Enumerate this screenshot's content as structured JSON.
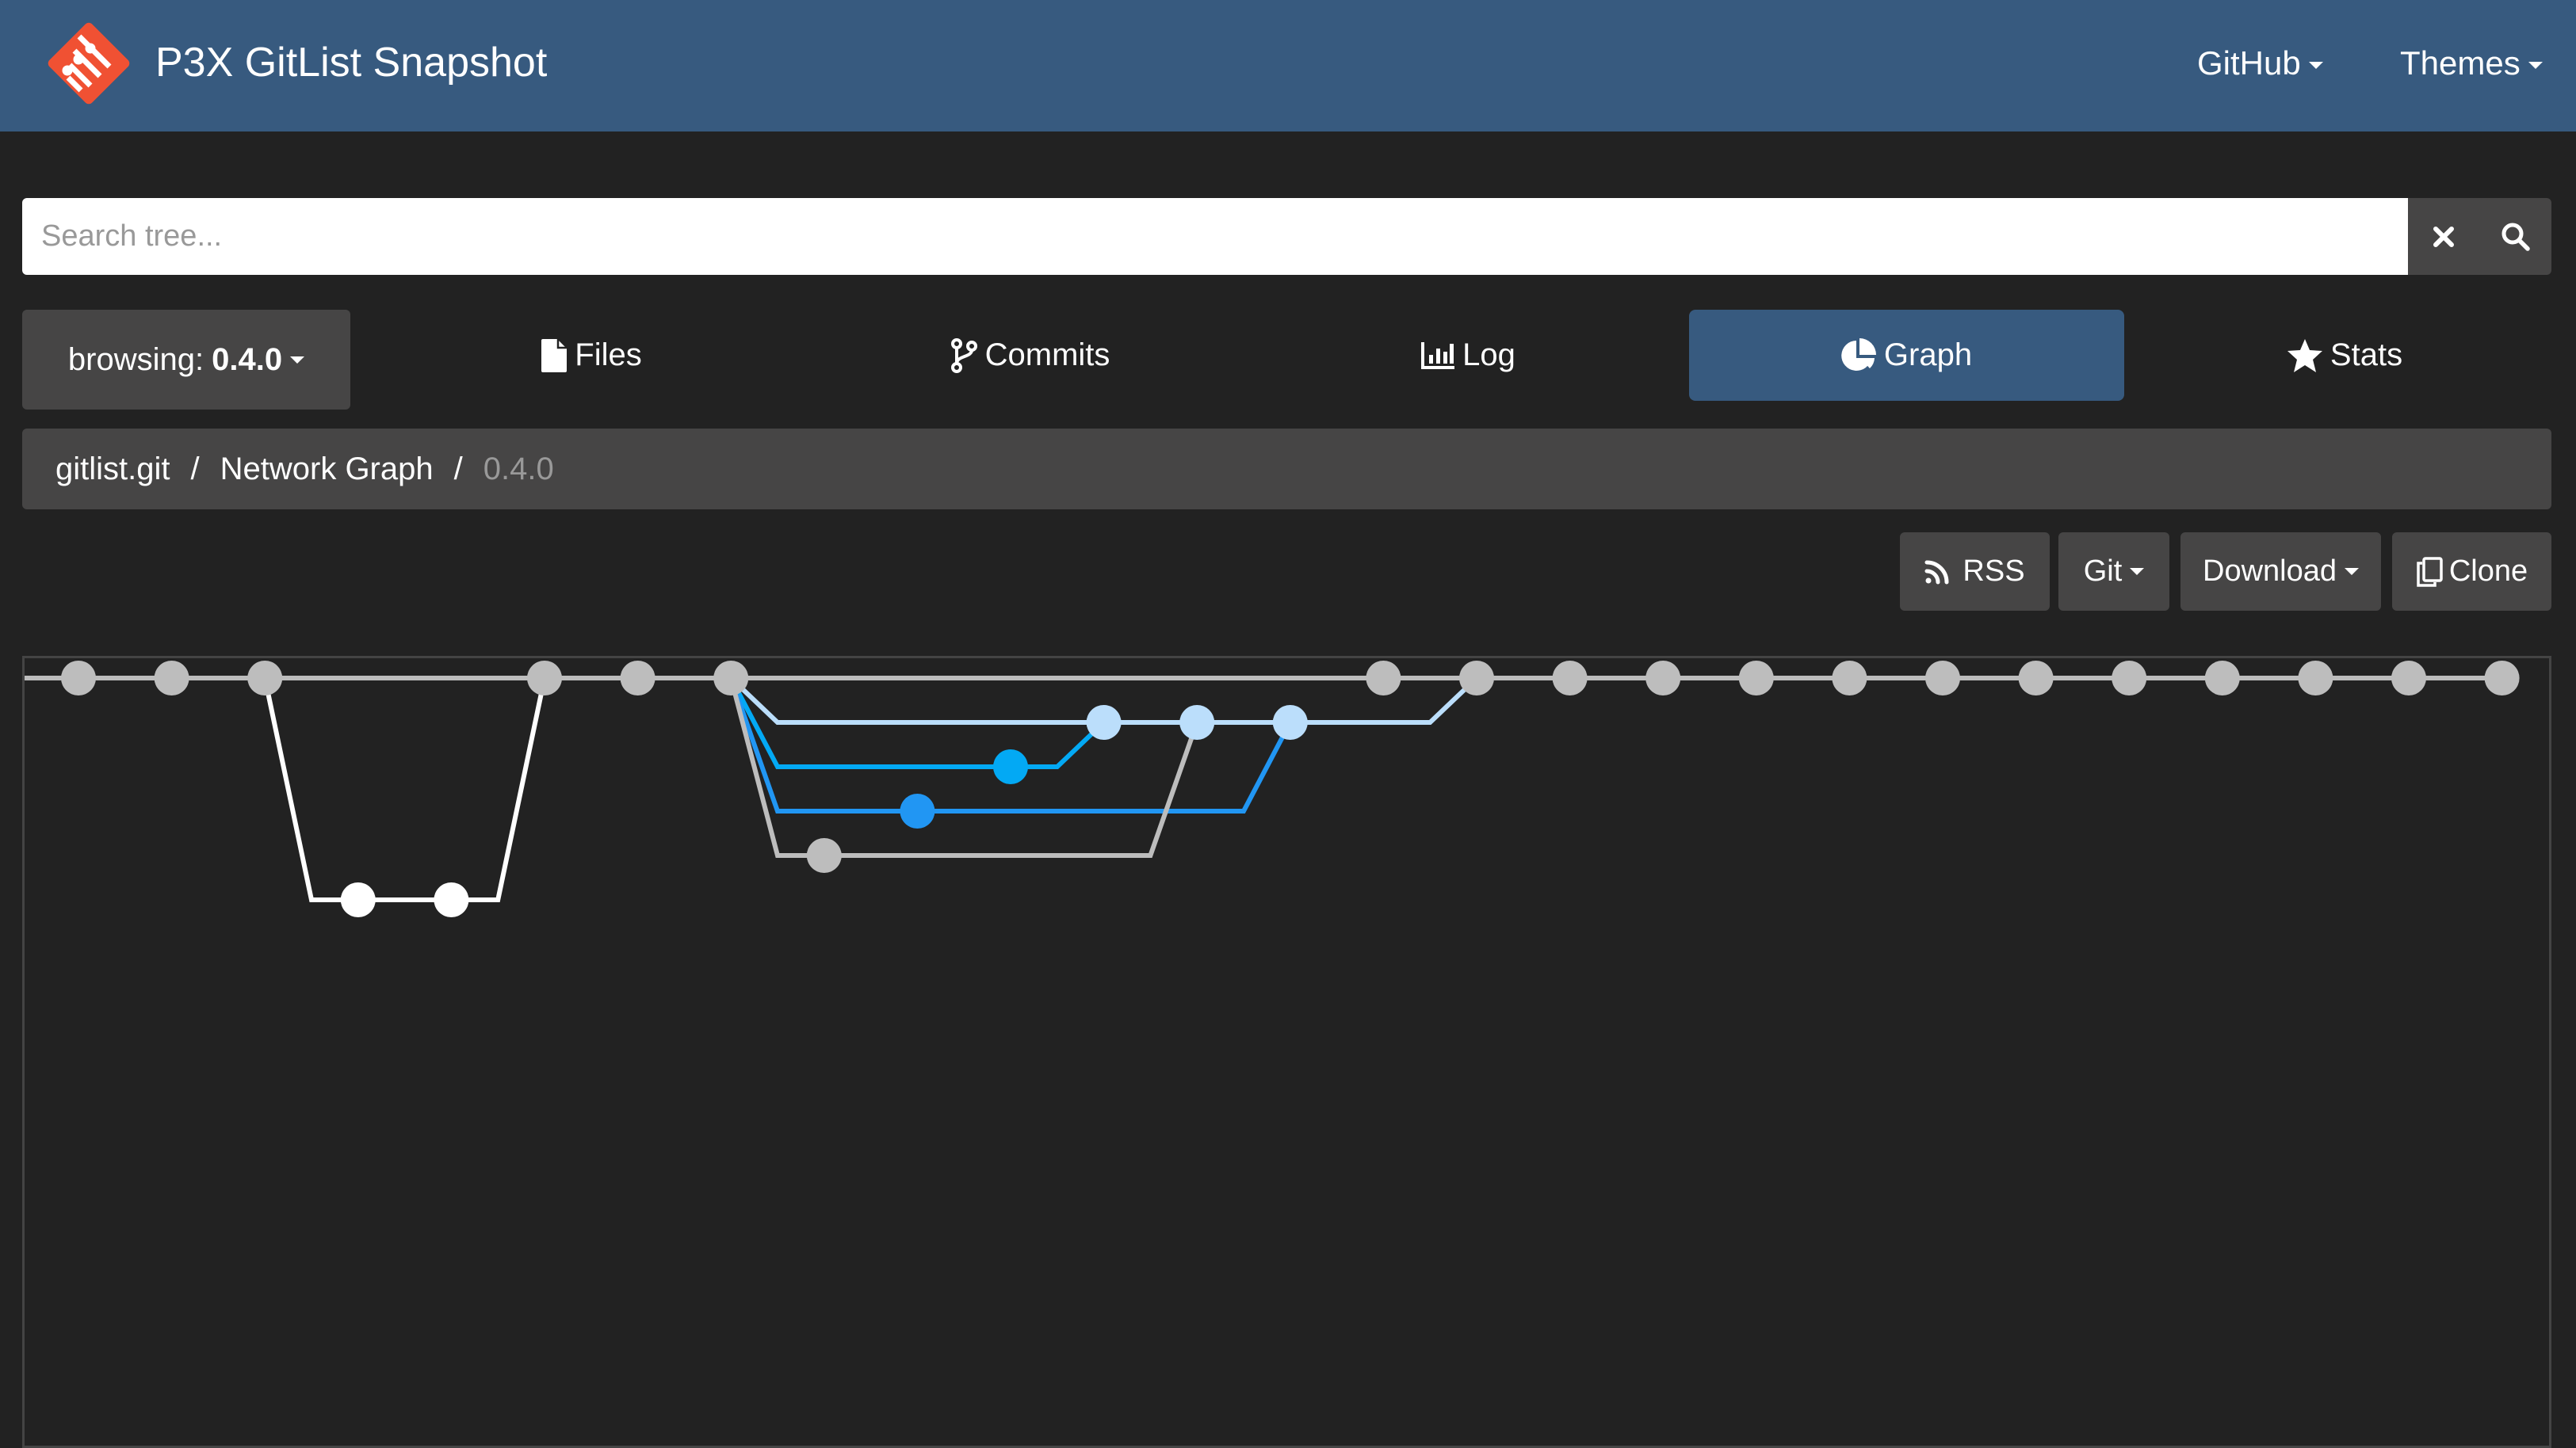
{
  "navbar": {
    "brand": "P3X GitList Snapshot",
    "logo": "gitlist-logo-icon",
    "menus": [
      {
        "label": "GitHub",
        "icon": "caret-down-icon"
      },
      {
        "label": "Themes",
        "icon": "caret-down-icon"
      }
    ]
  },
  "search": {
    "placeholder": "Search tree...",
    "value": "",
    "clear_icon": "close-icon",
    "search_icon": "search-icon"
  },
  "browsing": {
    "label": "browsing:",
    "ref": "0.4.0"
  },
  "tabs": [
    {
      "label": "Files",
      "icon": "file-icon",
      "active": false
    },
    {
      "label": "Commits",
      "icon": "code-branch-icon",
      "active": false
    },
    {
      "label": "Log",
      "icon": "chart-bar-icon",
      "active": false
    },
    {
      "label": "Graph",
      "icon": "chart-pie-icon",
      "active": true
    },
    {
      "label": "Stats",
      "icon": "star-icon",
      "active": false
    }
  ],
  "breadcrumb": {
    "items": [
      "gitlist.git",
      "Network Graph"
    ],
    "current": "0.4.0",
    "separator": "/"
  },
  "actions": [
    {
      "label": "RSS",
      "icon": "rss-icon"
    },
    {
      "label": "Git",
      "icon": "caret-down-icon"
    },
    {
      "label": "Download",
      "icon": "caret-down-icon"
    },
    {
      "label": "Clone",
      "icon": "copy-icon"
    }
  ],
  "network_graph": {
    "colors": {
      "main": "#bdbdbd",
      "white": "#ffffff",
      "light_blue": "#bbdefb",
      "cyan": "#03a9f4",
      "blue": "#2196f3",
      "grey": "#bdbdbd",
      "border": "#444444"
    },
    "commits": [
      {
        "slot": 0,
        "lane": 0,
        "color": "main"
      },
      {
        "slot": 1,
        "lane": 0,
        "color": "main"
      },
      {
        "slot": 2,
        "lane": 0,
        "color": "main"
      },
      {
        "slot": 3,
        "lane": 5,
        "color": "white"
      },
      {
        "slot": 4,
        "lane": 5,
        "color": "white"
      },
      {
        "slot": 5,
        "lane": 0,
        "color": "main"
      },
      {
        "slot": 6,
        "lane": 0,
        "color": "main"
      },
      {
        "slot": 7,
        "lane": 0,
        "color": "main"
      },
      {
        "slot": 8,
        "lane": 4,
        "color": "grey"
      },
      {
        "slot": 9,
        "lane": 3,
        "color": "blue"
      },
      {
        "slot": 10,
        "lane": 2,
        "color": "cyan"
      },
      {
        "slot": 11,
        "lane": 1,
        "color": "light_blue"
      },
      {
        "slot": 12,
        "lane": 1,
        "color": "light_blue"
      },
      {
        "slot": 13,
        "lane": 1,
        "color": "light_blue"
      },
      {
        "slot": 14,
        "lane": 0,
        "color": "main"
      },
      {
        "slot": 15,
        "lane": 0,
        "color": "main"
      },
      {
        "slot": 16,
        "lane": 0,
        "color": "main"
      },
      {
        "slot": 17,
        "lane": 0,
        "color": "main"
      },
      {
        "slot": 18,
        "lane": 0,
        "color": "main"
      },
      {
        "slot": 19,
        "lane": 0,
        "color": "main"
      },
      {
        "slot": 20,
        "lane": 0,
        "color": "main"
      },
      {
        "slot": 21,
        "lane": 0,
        "color": "main"
      },
      {
        "slot": 22,
        "lane": 0,
        "color": "main"
      },
      {
        "slot": 23,
        "lane": 0,
        "color": "main"
      },
      {
        "slot": 24,
        "lane": 0,
        "color": "main"
      },
      {
        "slot": 25,
        "lane": 0,
        "color": "main"
      },
      {
        "slot": 26,
        "lane": 0,
        "color": "main"
      }
    ],
    "branches": [
      {
        "name": "main",
        "color": "main",
        "lane": 0,
        "from": {
          "slot": -0.6,
          "lane": 0
        },
        "to": {
          "slot": 26,
          "lane": 0
        }
      },
      {
        "name": "white-branch",
        "color": "white",
        "lane": 5,
        "from": {
          "slot": 2,
          "lane": 0
        },
        "to": {
          "slot": 5,
          "lane": 0
        }
      },
      {
        "name": "light-blue-branch",
        "color": "light_blue",
        "lane": 1,
        "from": {
          "slot": 7,
          "lane": 0
        },
        "to": {
          "slot": 15,
          "lane": 0
        }
      },
      {
        "name": "cyan-branch",
        "color": "cyan",
        "lane": 2,
        "from": {
          "slot": 7,
          "lane": 0
        },
        "to": {
          "slot": 11,
          "lane": 1
        }
      },
      {
        "name": "blue-branch",
        "color": "blue",
        "lane": 3,
        "from": {
          "slot": 7,
          "lane": 0
        },
        "to": {
          "slot": 13,
          "lane": 1
        }
      },
      {
        "name": "grey-branch",
        "color": "grey",
        "lane": 4,
        "from": {
          "slot": 7,
          "lane": 0
        },
        "to": {
          "slot": 12,
          "lane": 1
        }
      }
    ]
  }
}
